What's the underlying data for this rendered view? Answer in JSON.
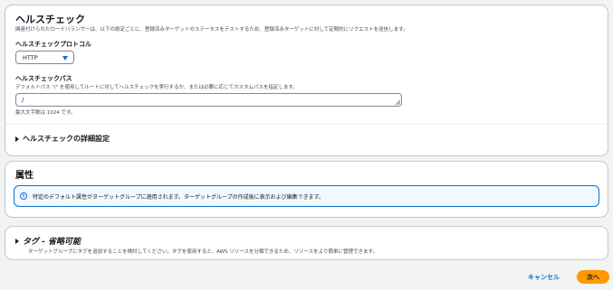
{
  "health_check": {
    "title": "ヘルスチェック",
    "description": "関連付けられたロードバランサーは、以下の設定ごとに、登録済みターゲットのステータスをテストするため、登録済みターゲットに対して定期的にリクエストを送信します。",
    "protocol_label": "ヘルスチェックプロトコル",
    "protocol_value": "HTTP",
    "path_label": "ヘルスチェックパス",
    "path_description": "デフォルトパス \"/\" を使用してルートに対してヘルスチェックを実行するか、または必要に応じてカスタムパスを指定します。",
    "path_value": "/",
    "path_constraint": "最大文字数は 1024 です。",
    "advanced_label": "ヘルスチェックの詳細設定"
  },
  "attributes": {
    "title": "属性",
    "info_text": "特定のデフォルト属性がターゲットグループに適用されます。ターゲットグループの作成後に表示および編集できます。"
  },
  "tags": {
    "title": "タグ - 省略可能",
    "description": "ターゲットグループにタグを追加することを検討してください。タグを使用すると、AWS リソースを分類できるため、リソースをより簡単に管理できます。"
  },
  "footer": {
    "cancel_label": "キャンセル",
    "next_label": "次へ"
  },
  "colors": {
    "accent": "#0972d3",
    "primary_button": "#ff9900",
    "info_background": "#f2f8fd"
  }
}
